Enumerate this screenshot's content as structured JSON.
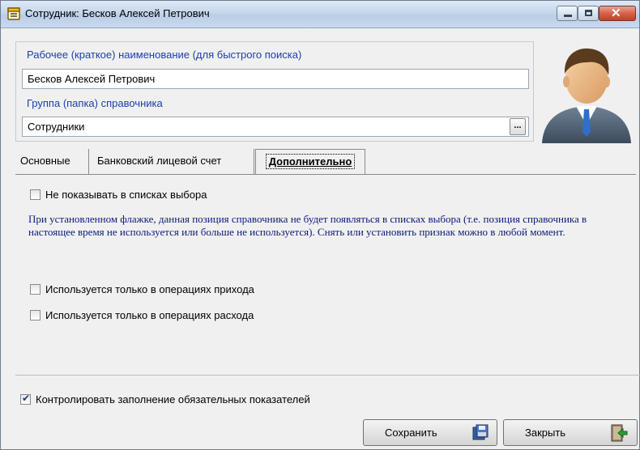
{
  "window": {
    "title": "Сотрудник: Бесков Алексей Петрович",
    "icon": "document-list-icon"
  },
  "header": {
    "name_label": "Рабочее (краткое) наименование (для быстрого поиска)",
    "name_value": "Бесков Алексей Петрович",
    "group_label": "Группа (папка) справочника",
    "group_value": "Сотрудники",
    "group_button": "..."
  },
  "tabs": [
    {
      "label": "Основные",
      "active": false
    },
    {
      "label": "Банковский лицевой счет",
      "active": false
    },
    {
      "label": "Дополнительно",
      "active": true
    }
  ],
  "extra": {
    "hide_in_lists_label": "Не показывать в списках выбора",
    "hide_in_lists_checked": false,
    "description": "При установленном флажке, данная позиция справочника не будет появляться в списках выбора (т.е. позиция справочника в настоящее время не используется или больше не используется). Снять или установить признак можно в любой момент.",
    "income_only_label": "Используется только в операциях прихода",
    "income_only_checked": false,
    "expense_only_label": "Используется только в операциях расхода",
    "expense_only_checked": false
  },
  "footer": {
    "control_required_label": "Контролировать заполнение обязательных показателей",
    "control_required_checked": true,
    "save_label": "Сохранить",
    "close_label": "Закрыть"
  },
  "colors": {
    "label_blue": "#1c3fa8",
    "description_text": "#0b1a7a",
    "titlebar": "#c5d6ec"
  }
}
